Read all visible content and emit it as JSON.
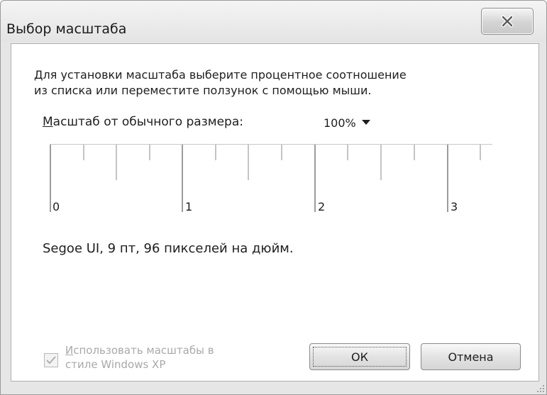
{
  "window": {
    "title": "Выбор масштаба",
    "close_icon": "close-icon"
  },
  "description": {
    "line1": "Для установки масштаба выберите процентное соотношение",
    "line2": "из списка или переместите ползунок с помощью мыши."
  },
  "scale": {
    "label_access_key": "М",
    "label_rest": "асштаб от обычного размера:",
    "selected": "100%",
    "dropdown_icon": "chevron-down-icon"
  },
  "ruler": {
    "labels": [
      "0",
      "1",
      "2",
      "3"
    ]
  },
  "font_info": "Segoe UI, 9 пт, 96 пикселей на дюйм.",
  "xp_scaling": {
    "checked": true,
    "enabled": false,
    "label_access_key": "И",
    "label_line1_rest": "спользовать масштабы в",
    "label_line2": "стиле Windows XP"
  },
  "buttons": {
    "ok": "ОК",
    "cancel": "Отмена"
  },
  "colors": {
    "window_bg": "#e6e6e6",
    "client_bg": "#ffffff",
    "disabled_text": "#a9a9a9"
  }
}
